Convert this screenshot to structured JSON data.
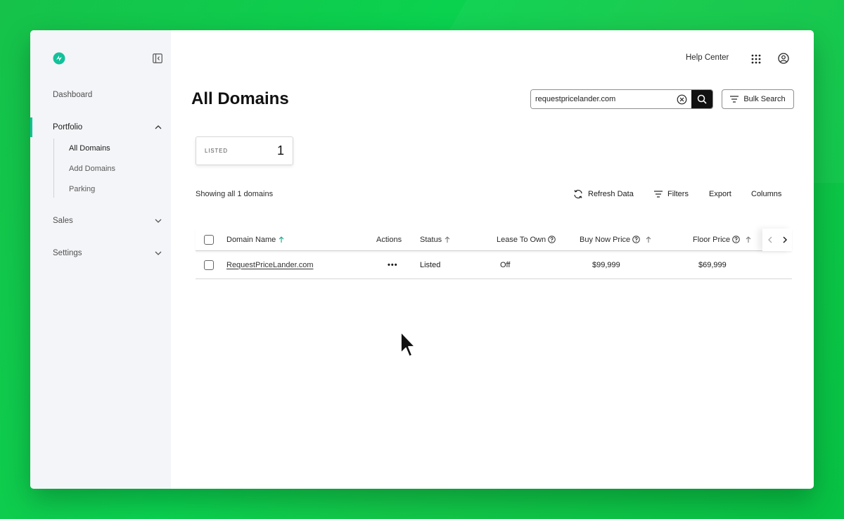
{
  "sidebar": {
    "nav": [
      {
        "label": "Dashboard"
      },
      {
        "label": "Portfolio"
      },
      {
        "label": "Sales"
      },
      {
        "label": "Settings"
      }
    ],
    "portfolio_sub": [
      {
        "label": "All Domains"
      },
      {
        "label": "Add Domains"
      },
      {
        "label": "Parking"
      }
    ]
  },
  "header": {
    "help_center": "Help Center",
    "page_title": "All Domains"
  },
  "search": {
    "value": "requestpricelander.com",
    "bulk_label": "Bulk Search"
  },
  "stats": {
    "listed_label": "LISTED",
    "listed_count": "1"
  },
  "list": {
    "showing": "Showing all 1 domains",
    "toolbar": {
      "refresh": "Refresh Data",
      "filters": "Filters",
      "export": "Export",
      "columns": "Columns"
    }
  },
  "table": {
    "headers": {
      "domain": "Domain Name",
      "actions": "Actions",
      "status": "Status",
      "lease": "Lease To Own",
      "buy_now": "Buy Now Price",
      "floor": "Floor Price"
    },
    "rows": [
      {
        "domain": "RequestPriceLander.com",
        "actions": "•••",
        "status": "Listed",
        "lease": "Off",
        "buy_now": "$99,999",
        "floor": "$69,999"
      }
    ]
  },
  "colors": {
    "accent": "#13c19a",
    "background_green": "#0ad24f",
    "sidebar_bg": "#f4f5f8"
  }
}
